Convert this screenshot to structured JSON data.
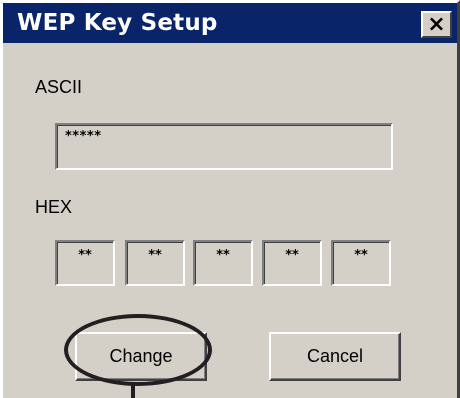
{
  "window": {
    "title": "WEP Key Setup",
    "close_glyph": "×"
  },
  "ascii": {
    "label": "ASCII",
    "value": "*****"
  },
  "hex": {
    "label": "HEX",
    "fields": [
      "**",
      "**",
      "**",
      "**",
      "**"
    ]
  },
  "buttons": {
    "change_label": "Change",
    "cancel_label": "Cancel"
  },
  "icons": {
    "close": "close-icon"
  },
  "colors": {
    "titlebar": "#0a246a",
    "dialog_bg": "#d4d0c8",
    "callout": "#231f20"
  }
}
